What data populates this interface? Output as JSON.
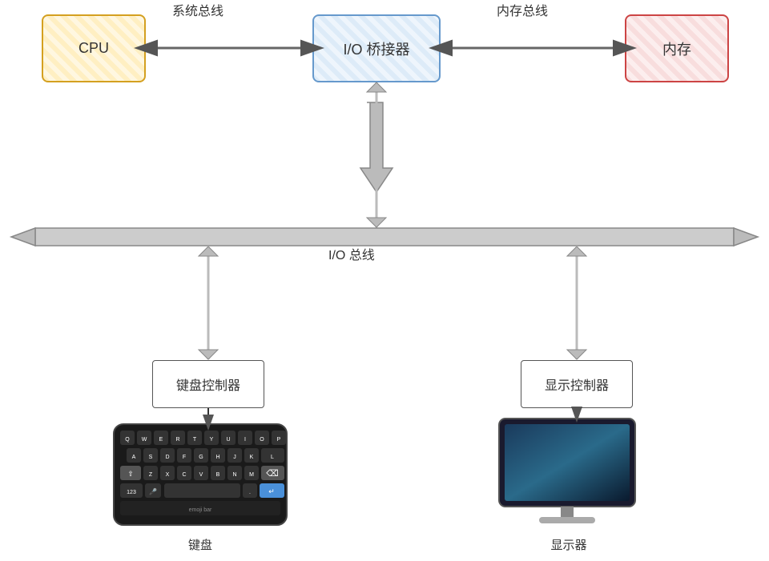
{
  "boxes": {
    "cpu": {
      "label": "CPU"
    },
    "io_bridge": {
      "label": "I/O 桥接器"
    },
    "mem": {
      "label": "内存"
    },
    "kbd_ctrl": {
      "label": "键盘控制器"
    },
    "disp_ctrl": {
      "label": "显示控制器"
    }
  },
  "labels": {
    "sys_bus": "系统总线",
    "mem_bus": "内存总线",
    "io_bus": "I/O 总线",
    "keyboard": "键盘",
    "monitor": "显示器"
  }
}
